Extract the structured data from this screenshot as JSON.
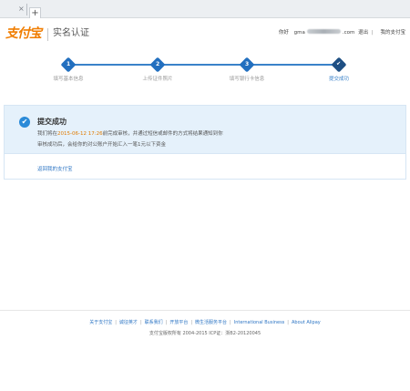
{
  "browser": {
    "close_tab_glyph": "×",
    "new_tab_glyph": "+"
  },
  "header": {
    "logo_text": "支付宝",
    "page_heading": "实名认证",
    "greeting": "你好",
    "email_prefix": "gma",
    "email_suffix": ".com",
    "logout": "退出",
    "my_alipay": "我的支付宝",
    "separator": "|"
  },
  "steps": [
    {
      "number": "1",
      "label": "填写基本信息",
      "state": "completed"
    },
    {
      "number": "2",
      "label": "上传证件照片",
      "state": "completed"
    },
    {
      "number": "3",
      "label": "填写银行卡信息",
      "state": "completed"
    },
    {
      "number": "",
      "label": "提交成功",
      "state": "current",
      "icon": "check-icon"
    }
  ],
  "result": {
    "title": "提交成功",
    "message_before": "我们将在",
    "deadline": "2015-06-12 17:26",
    "message_after": "前完成审核，并通过短信或邮件的方式将结果通知到你",
    "message_line2": "审核成功后，会给你的对公账户开始汇入一笔1元以下资金",
    "back_link": "返回我的支付宝",
    "icon": "check-circle-icon"
  },
  "footer": {
    "links": [
      "关于支付宝",
      "诚征英才",
      "联系我们",
      "开放平台",
      "微生活服务平台",
      "International Business",
      "About Alipay"
    ],
    "separator": "|",
    "copyright": "支付宝版权所有 2004-2015 ICP证：浙B2-20120045"
  },
  "colors": {
    "brand_orange": "#f07d00",
    "step_blue": "#226fbf",
    "link_blue": "#2d75c4",
    "success_bg": "#e5f1fb",
    "deadline_orange": "#e07b00"
  }
}
